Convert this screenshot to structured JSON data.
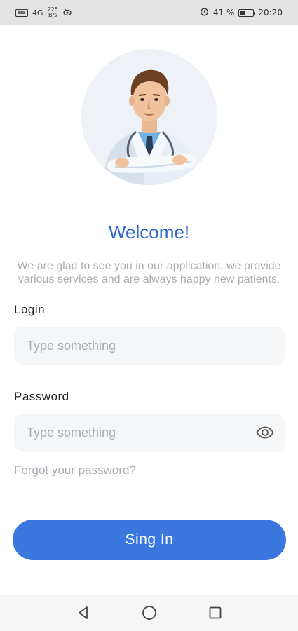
{
  "status_bar": {
    "left": {
      "chip": "N5",
      "signal": "4G",
      "speed_top": "225",
      "speed_bottom": "B/s"
    },
    "right": {
      "battery_pct": "41 %",
      "battery_level": 0.41,
      "time": "20:20"
    }
  },
  "welcome": {
    "title": "Welcome!",
    "subtitle": "We are glad to see you in our application, we provide various services and are always happy new patients."
  },
  "login": {
    "label": "Login",
    "placeholder": "Type something",
    "value": ""
  },
  "password": {
    "label": "Password",
    "placeholder": "Type something",
    "value": ""
  },
  "forgot_link": "Forgot your password?",
  "signin_label": "Sing In",
  "colors": {
    "accent": "#3a78df",
    "title": "#2b67c8",
    "muted": "#a7acb3",
    "field_bg": "#f5f6f8"
  }
}
